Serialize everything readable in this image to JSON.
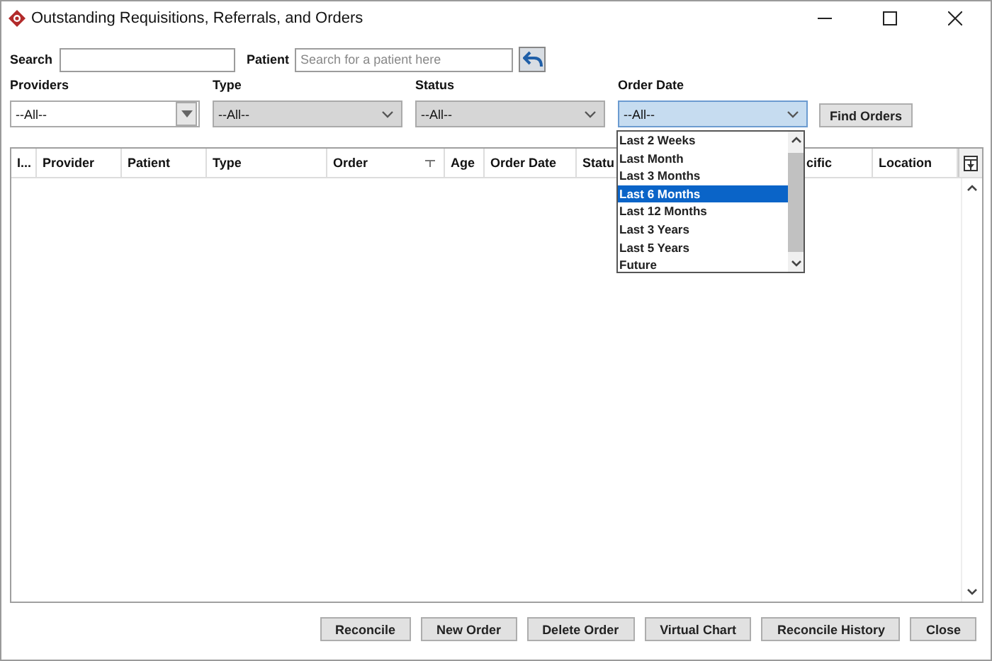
{
  "window": {
    "title": "Outstanding Requisitions, Referrals, and Orders"
  },
  "search": {
    "label": "Search"
  },
  "patient": {
    "label": "Patient",
    "placeholder": "Search for a patient here"
  },
  "filters": [
    {
      "label": "Providers",
      "value": "--All--",
      "kind": "combo",
      "open": false
    },
    {
      "label": "Type",
      "value": "--All--",
      "kind": "select",
      "open": false
    },
    {
      "label": "Status",
      "value": "--All--",
      "kind": "select",
      "open": false
    },
    {
      "label": "Order Date",
      "value": "--All--",
      "kind": "select",
      "open": true
    }
  ],
  "find_button": "Find Orders",
  "dropdown": {
    "options": [
      {
        "label": "Last 2 Weeks",
        "selected": false
      },
      {
        "label": "Last Month",
        "selected": false
      },
      {
        "label": "Last 3 Months",
        "selected": false
      },
      {
        "label": "Last 6 Months",
        "selected": true
      },
      {
        "label": "Last 12 Months",
        "selected": false
      },
      {
        "label": "Last 3 Years",
        "selected": false
      },
      {
        "label": "Last 5 Years",
        "selected": false
      },
      {
        "label": "Future",
        "selected": false
      }
    ]
  },
  "table": {
    "columns": [
      {
        "label": "I..."
      },
      {
        "label": "Provider"
      },
      {
        "label": "Patient"
      },
      {
        "label": "Type"
      },
      {
        "label": "Order",
        "sorted": true
      },
      {
        "label": "Age"
      },
      {
        "label": "Order Date"
      },
      {
        "label": "Statu"
      },
      {
        "label": "cific"
      },
      {
        "label": "Location"
      }
    ]
  },
  "buttons": [
    "Reconcile",
    "New Order",
    "Delete Order",
    "Virtual Chart",
    "Reconcile History",
    "Close"
  ]
}
